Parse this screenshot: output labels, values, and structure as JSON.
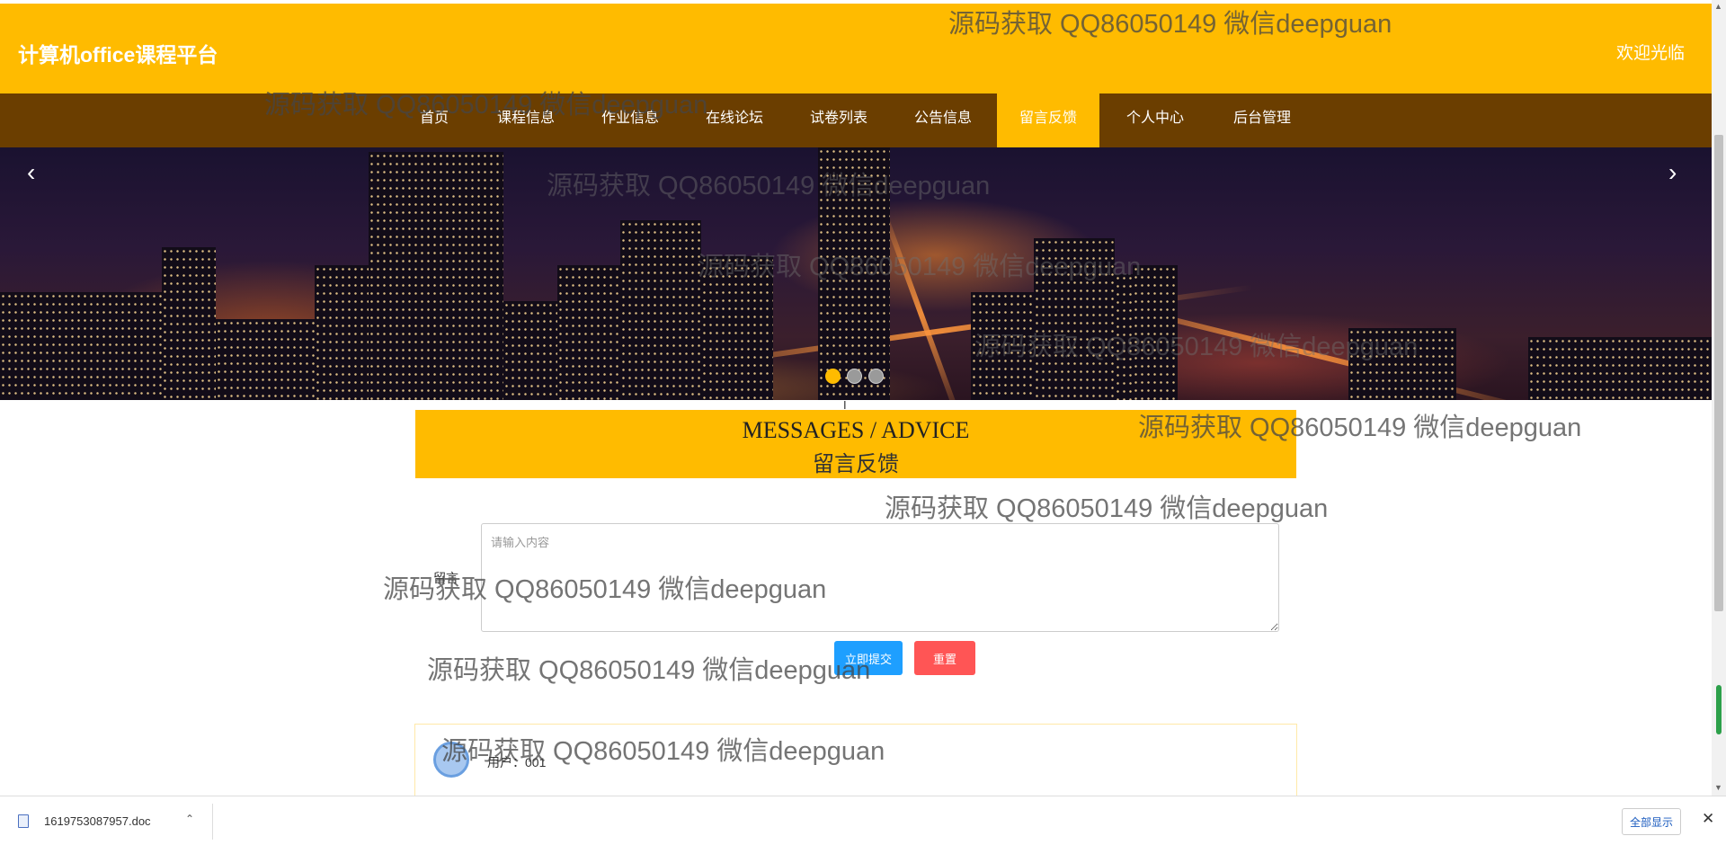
{
  "header": {
    "site_title": "计算机office课程平台",
    "welcome": "欢迎光临"
  },
  "nav": {
    "items": [
      {
        "label": "首页"
      },
      {
        "label": "课程信息"
      },
      {
        "label": "作业信息"
      },
      {
        "label": "在线论坛"
      },
      {
        "label": "试卷列表"
      },
      {
        "label": "公告信息"
      },
      {
        "label": "留言反馈",
        "active": true
      },
      {
        "label": "个人中心"
      },
      {
        "label": "后台管理"
      }
    ]
  },
  "banner": {
    "prev_icon": "chevron-left-icon",
    "next_icon": "chevron-right-icon",
    "prev_glyph": "‹",
    "next_glyph": "›",
    "slide_count": 3,
    "active_slide": 1
  },
  "messages": {
    "title_en": "MESSAGES / ADVICE",
    "title_cn": "留言反馈"
  },
  "form": {
    "label": "留言",
    "placeholder": "请输入内容",
    "submit_label": "立即提交",
    "reset_label": "重置"
  },
  "comment": {
    "user": "用户：001"
  },
  "watermark": "源码获取 QQ86050149 微信deepguan",
  "download_bar": {
    "file_name": "1619753087957.doc",
    "chevron": "⌃",
    "show_all": "全部显示",
    "close": "✕"
  },
  "scrollbar": {
    "up": "▲",
    "down": "▼"
  },
  "colors": {
    "header": "#ffbb00",
    "nav": "#6b3e00",
    "accent": "#ffbb00",
    "submit": "#1e9fff",
    "reset": "#ff5555"
  }
}
